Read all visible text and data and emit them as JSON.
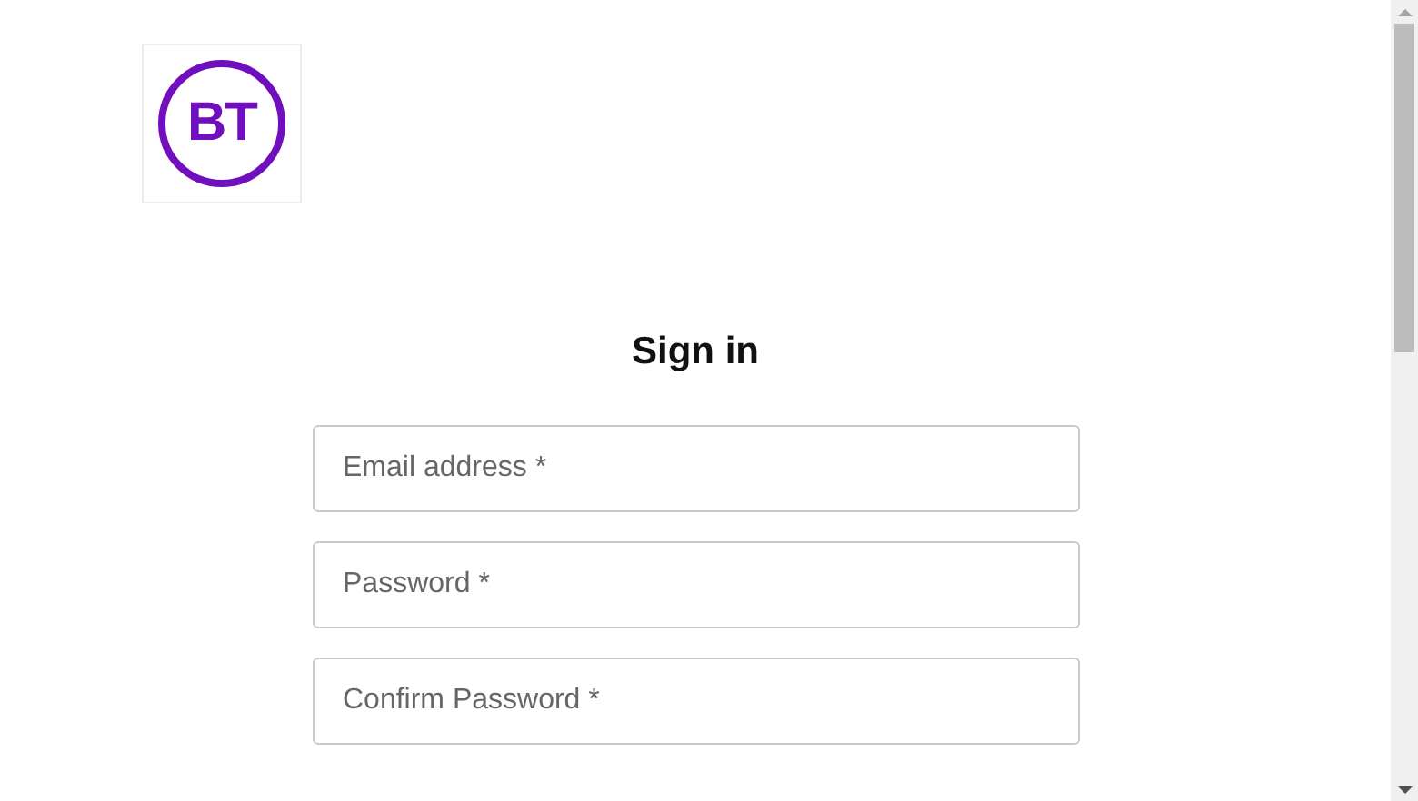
{
  "logo": {
    "text": "BT"
  },
  "heading": "Sign in",
  "fields": [
    {
      "placeholder": "Email address *"
    },
    {
      "placeholder": "Password *"
    },
    {
      "placeholder": "Confirm Password *"
    }
  ]
}
